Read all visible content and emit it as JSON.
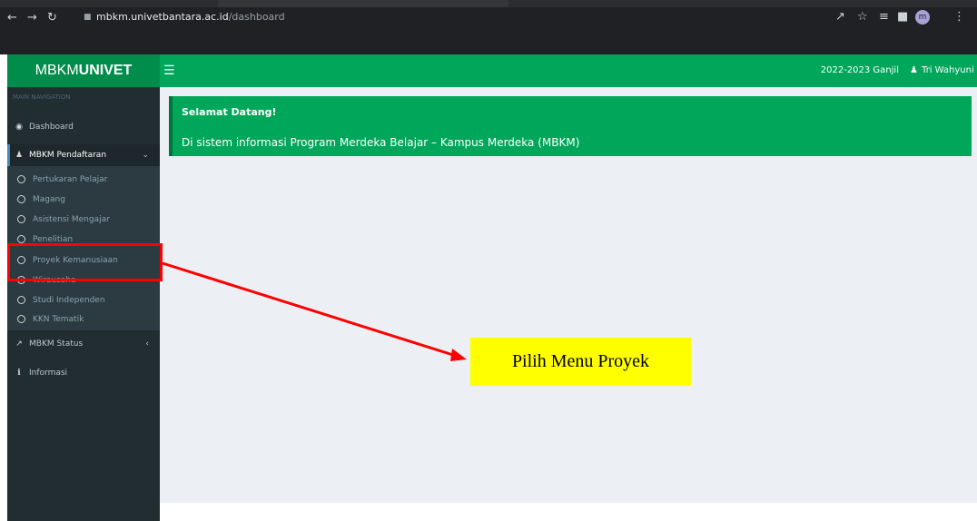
{
  "browser": {
    "url_host": "mbkm.univetbantara.ac.id",
    "url_path": "/dashboard",
    "profile_initial": "m"
  },
  "header": {
    "logo_prefix": "MBKM",
    "logo_suffix": "UNIVET",
    "menu_icon": "hamburger-icon",
    "academic_year": "2022-2023 Ganjil",
    "user_name": "Tri Wahyuni"
  },
  "sidebar": {
    "nav_header": "MAIN NAVIGATION",
    "items": [
      {
        "label": "Dashboard",
        "icon": "dashboard-icon"
      },
      {
        "label": "MBKM Pendaftaran",
        "icon": "users-icon"
      }
    ],
    "sub_items": [
      "Pertukaran Pelajar",
      "Magang",
      "Asistensi Mengajar",
      "Penelitian",
      "Proyek Kemanusiaan",
      "Wirausaha",
      "Studi Independen",
      "KKN Tematik"
    ],
    "bottom_items": [
      {
        "label": "MBKM Status",
        "icon": "chart-icon"
      },
      {
        "label": "Informasi",
        "icon": "info-icon"
      }
    ]
  },
  "alert": {
    "title": "Selamat Datang!",
    "message": "Di sistem informasi Program Merdeka Belajar – Kampus Merdeka (MBKM)"
  },
  "annotation": {
    "callout": "Pilih Menu Proyek"
  },
  "colors": {
    "header_green": "#00a65a",
    "logo_green": "#008d4c",
    "sidebar_dark": "#222d32",
    "content_bg": "#ecf0f5",
    "highlight_red": "#ff0000",
    "callout_yellow": "#ffff00"
  }
}
